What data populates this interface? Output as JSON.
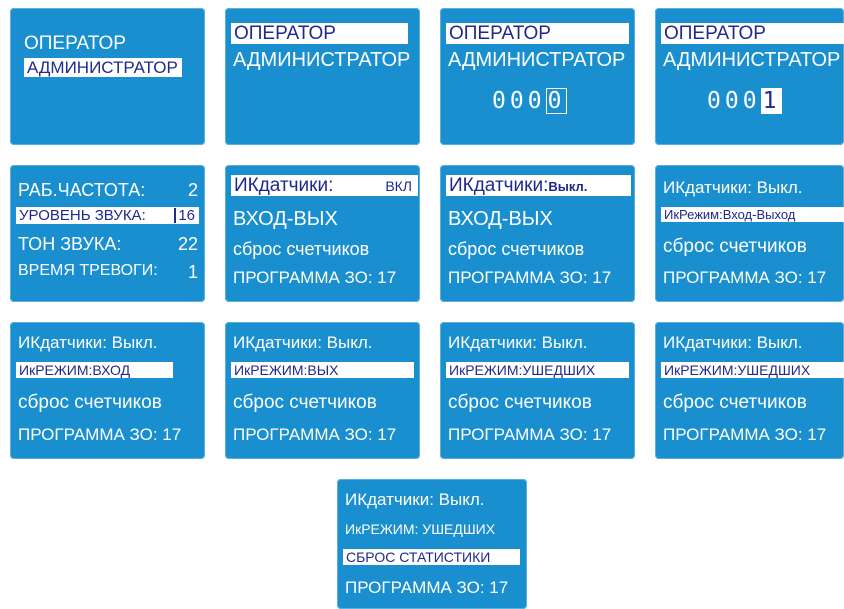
{
  "screens": [
    {
      "id": "s1",
      "lines": [
        "ОПЕРАТОР",
        "АДМИНИСТРАТОР"
      ]
    },
    {
      "id": "s2",
      "lines": [
        "ОПЕРАТОР",
        "АДМИНИСТРАТОР"
      ]
    },
    {
      "id": "s3",
      "lines": [
        "ОПЕРАТОР",
        "АДМИНИСТРАТОР"
      ],
      "digits": [
        "0",
        "0",
        "0",
        "0"
      ]
    },
    {
      "id": "s4",
      "lines": [
        "ОПЕРАТОР",
        "АДМИНИСТРАТОР"
      ],
      "digits": [
        "0",
        "0",
        "0",
        "1"
      ]
    },
    {
      "id": "s5",
      "rows": [
        {
          "label": "РАБ.ЧАСТОТА:",
          "value": "2"
        },
        {
          "label": "УРОВЕНЬ ЗВУКА:",
          "value": "16"
        },
        {
          "label": "ТОН ЗВУКА:",
          "value": "22"
        },
        {
          "label": "ВРЕМЯ ТРЕВОГИ:",
          "value": "1"
        }
      ]
    },
    {
      "id": "s6",
      "ir_label": "ИКдатчики:",
      "ir_value": "ВКЛ",
      "lines": [
        "ВХОД-ВЫХ",
        "сброс счетчиков",
        "ПРОГРАММА ЗО: 17"
      ]
    },
    {
      "id": "s7",
      "ir_label": "ИКдатчики:",
      "ir_value": "Выкл.",
      "lines": [
        "ВХОД-ВЫХ",
        "сброс счетчиков",
        "ПРОГРАММА ЗО: 17"
      ]
    },
    {
      "id": "s8",
      "lines": [
        "ИКдатчики: Выкл.",
        "ИкРежим:Вход-Выход",
        "сброс счетчиков",
        "ПРОГРАММА ЗО: 17"
      ]
    },
    {
      "id": "s9",
      "lines": [
        "ИКдатчики: Выкл.",
        "ИкРЕЖИМ:ВХОД",
        "сброс счетчиков",
        "ПРОГРАММА ЗО: 17"
      ]
    },
    {
      "id": "s10",
      "lines": [
        "ИКдатчики: Выкл.",
        "ИкРЕЖИМ:ВЫХ",
        "сброс счетчиков",
        "ПРОГРАММА ЗО: 17"
      ]
    },
    {
      "id": "s11",
      "lines": [
        "ИКдатчики: Выкл.",
        "ИкРЕЖИМ:УШЕДШИХ",
        "сброс счетчиков",
        "ПРОГРАММА ЗО: 17"
      ]
    },
    {
      "id": "s12",
      "lines": [
        "ИКдатчики: Выкл.",
        "ИкРЕЖИМ:УШЕДШИХ",
        "сброс счетчиков",
        "ПРОГРАММА ЗО: 17"
      ]
    },
    {
      "id": "s13",
      "lines": [
        "ИКдатчики: Выкл.",
        "ИкРЕЖИМ: УШЕДШИХ",
        "СБРОС СТАТИСТИКИ",
        "ПРОГРАММА ЗО: 17"
      ]
    }
  ],
  "colors": {
    "screen_background": "#1a8fd0",
    "text": "#ffffff",
    "highlight_background": "#ffffff",
    "highlight_text": "#1f2a8c"
  }
}
